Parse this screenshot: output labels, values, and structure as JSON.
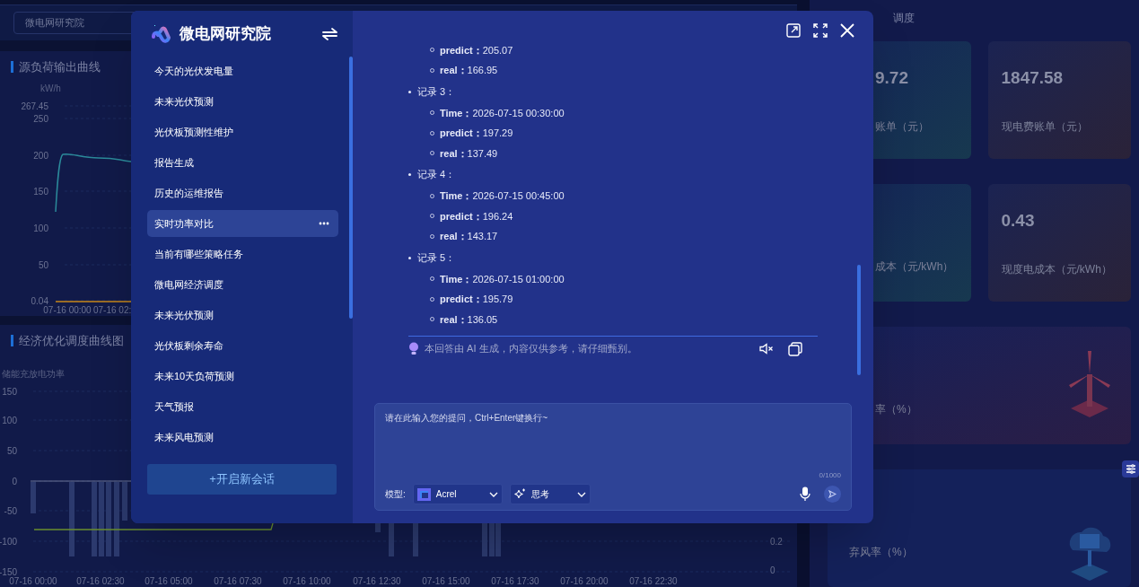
{
  "dashboard": {
    "site_select": {
      "value": "微电网研究院"
    },
    "panels": [
      {
        "title": "源负荷输出曲线",
        "axis_label": "kW/h",
        "y_ticks": [
          "267.45",
          "250",
          "200",
          "150",
          "100",
          "50",
          "0.04"
        ],
        "x_ticks": [
          "07-16 00:00",
          "07-16 02:"
        ]
      },
      {
        "title": "经济优化调度曲线图",
        "axis_label": "储能充放电功率",
        "y_ticks": [
          "150",
          "100",
          "50",
          "0",
          "-50",
          "-100",
          "-150"
        ],
        "x_ticks": [
          "07-16 00:00",
          "07-16 02:30",
          "07-16 05:00",
          "07-16 07:30",
          "07-16 10:00",
          "07-16 12:30",
          "07-16 15:00",
          "07-16 17:30",
          "07-16 20:00",
          "07-16 22:30"
        ],
        "right_ticks": [
          "0.2",
          "0"
        ]
      }
    ],
    "right_title": "调度",
    "stat_cards": [
      {
        "kind": "teal",
        "value": "9.72",
        "label": "账单（元）"
      },
      {
        "kind": "brown",
        "value": "1847.58",
        "label": "现电费账单（元）"
      },
      {
        "kind": "teal",
        "label": "成本（元/kWh）"
      },
      {
        "kind": "brown",
        "value": "0.43",
        "label": "现度电成本（元/kWh）"
      },
      {
        "kind": "wind",
        "label": "率（%）"
      },
      {
        "kind": "solar",
        "label": "弃风率（%）"
      }
    ]
  },
  "assistant": {
    "title": "微电网研究院",
    "conversations": [
      {
        "label": "今天的光伏发电量",
        "selected": false
      },
      {
        "label": "未来光伏预测",
        "selected": false
      },
      {
        "label": "光伏板预测性维护",
        "selected": false
      },
      {
        "label": "报告生成",
        "selected": false
      },
      {
        "label": "历史的运维报告",
        "selected": false
      },
      {
        "label": "实时功率对比",
        "selected": true
      },
      {
        "label": "当前有哪些策略任务",
        "selected": false
      },
      {
        "label": "微电网经济调度",
        "selected": false
      },
      {
        "label": "未来光伏预测",
        "selected": false
      },
      {
        "label": "光伏板剩余寿命",
        "selected": false
      },
      {
        "label": "未来10天负荷预测",
        "selected": false
      },
      {
        "label": "天气预报",
        "selected": false
      },
      {
        "label": "未来风电预测",
        "selected": false
      }
    ],
    "new_chat_button": "+开启新会话",
    "records": [
      {
        "fields": [
          {
            "key": "predict：",
            "value": "205.07"
          },
          {
            "key": "real：",
            "value": "166.95"
          }
        ]
      },
      {
        "label": "记录 3：",
        "fields": [
          {
            "key": "Time：",
            "value": "2026-07-15 00:30:00"
          },
          {
            "key": "predict：",
            "value": "197.29"
          },
          {
            "key": "real：",
            "value": "137.49"
          }
        ]
      },
      {
        "label": "记录 4：",
        "fields": [
          {
            "key": "Time：",
            "value": "2026-07-15 00:45:00"
          },
          {
            "key": "predict：",
            "value": "196.24"
          },
          {
            "key": "real：",
            "value": "143.17"
          }
        ]
      },
      {
        "label": "记录 5：",
        "fields": [
          {
            "key": "Time：",
            "value": "2026-07-15 01:00:00"
          },
          {
            "key": "predict：",
            "value": "195.79"
          },
          {
            "key": "real：",
            "value": "136.05"
          }
        ]
      }
    ],
    "disclaimer": "本回答由 AI 生成，内容仅供参考，请仔细甄别。",
    "input": {
      "placeholder": "请在此输入您的提问，Ctrl+Enter键换行~",
      "counter": "0/1000"
    },
    "model_label": "模型:",
    "model_select": {
      "value": "Acrel"
    },
    "mode_select": {
      "value": "思考"
    }
  }
}
